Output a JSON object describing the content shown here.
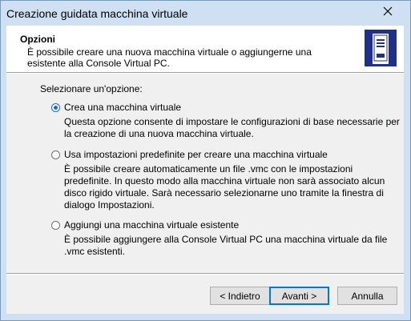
{
  "window": {
    "title": "Creazione guidata macchina virtuale",
    "close_glyph": "close-icon"
  },
  "header": {
    "title": "Opzioni",
    "description": "È possibile creare una nuova macchina virtuale o aggiungerne una esistente alla Console Virtual PC.",
    "icon": "virtual-pc-server-icon"
  },
  "body": {
    "prompt": "Selezionare un'opzione:",
    "options": [
      {
        "label": "Crea una macchina virtuale",
        "description": "Questa opzione consente di impostare le configurazioni di base necessarie per la creazione di una nuova macchina virtuale.",
        "selected": true
      },
      {
        "label": "Usa impostazioni predefinite per creare una macchina virtuale",
        "description": "È possibile creare automaticamente un file .vmc con le impostazioni predefinite. In questo modo alla macchina virtuale non sarà associato alcun disco rigido virtuale. Sarà necessario selezionarne uno tramite la finestra di dialogo Impostazioni.",
        "selected": false
      },
      {
        "label": "Aggiungi una macchina virtuale esistente",
        "description": "È possibile aggiungere alla Console Virtual PC una macchina virtuale da file .vmc esistenti.",
        "selected": false
      }
    ]
  },
  "footer": {
    "back_label": "< Indietro",
    "next_label": "Avanti >",
    "cancel_label": "Annulla"
  },
  "colors": {
    "frame": "#cfe0f2",
    "accent": "#0078d7",
    "icon_blue": "#1f2f8a"
  }
}
